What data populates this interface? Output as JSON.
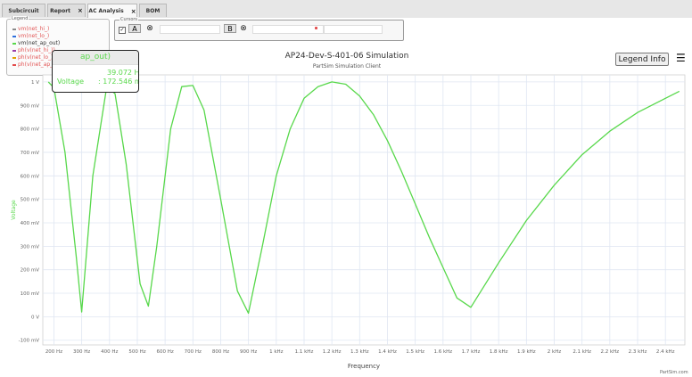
{
  "tabs": [
    {
      "label": "Subcircuit",
      "active": false,
      "close": ""
    },
    {
      "label": "Report",
      "active": false,
      "close": "×"
    },
    {
      "label": "AC Analysis",
      "active": true,
      "close": "×"
    },
    {
      "label": "BOM",
      "active": false,
      "close": ""
    }
  ],
  "cursors": {
    "title": "Cursors",
    "checkbox": "✓",
    "button_a": "A",
    "button_b": "B",
    "x_icon": "⊗"
  },
  "legend": {
    "title": "Legend",
    "items": [
      {
        "label": "vm(net_hi_)",
        "color": "#8a8a8a",
        "selected": false
      },
      {
        "label": "vm(net_lo_)",
        "color": "#2f6fdc",
        "selected": false
      },
      {
        "label": "vm(net_ap_out)",
        "color": "#58d84b",
        "selected": true
      },
      {
        "label": "ph(v(net_hi_))",
        "color": "#9a3ca8",
        "selected": false
      },
      {
        "label": "ph(v(net_lo_))",
        "color": "#e3a000",
        "selected": false
      },
      {
        "label": "ph(v(net_ap_out))",
        "color": "#e34b4b",
        "selected": false
      }
    ]
  },
  "tooltip": {
    "header": "ap_out)",
    "frequency": "39.072 Hz",
    "voltage_label": "Voltage",
    "voltage_value": ": 172.546 mV"
  },
  "header": {
    "title": "AP24-Dev-S-401-06 Simulation",
    "subtitle": "PartSim Simulation Client",
    "legend_info": "Legend Info",
    "menu_icon": "☰"
  },
  "watermark": "PartSim.com",
  "chart_data": {
    "type": "line",
    "xlabel": "Frequency",
    "ylabel": "Voltage",
    "xlim": [
      160,
      2470
    ],
    "ylim": [
      -120,
      1030
    ],
    "x_ticks": [
      200,
      300,
      400,
      500,
      600,
      700,
      800,
      900,
      1000,
      1100,
      1200,
      1300,
      1400,
      1500,
      1600,
      1700,
      1800,
      1900,
      2000,
      2100,
      2200,
      2300,
      2400
    ],
    "x_tick_labels": [
      "200 Hz",
      "300 Hz",
      "400 Hz",
      "500 Hz",
      "600 Hz",
      "700 Hz",
      "800 Hz",
      "900 Hz",
      "1 kHz",
      "1.1 kHz",
      "1.2 kHz",
      "1.3 kHz",
      "1.4 kHz",
      "1.5 kHz",
      "1.6 kHz",
      "1.7 kHz",
      "1.8 kHz",
      "1.9 kHz",
      "2 kHz",
      "2.1 kHz",
      "2.2 kHz",
      "2.3 kHz",
      "2.4 kHz"
    ],
    "y_ticks": [
      -100,
      0,
      100,
      200,
      300,
      400,
      500,
      600,
      700,
      800,
      900,
      1000
    ],
    "y_tick_labels": [
      "-100 mV",
      "0 V",
      "100 mV",
      "200 mV",
      "300 mV",
      "400 mV",
      "500 mV",
      "600 mV",
      "700 mV",
      "800 mV",
      "900 mV",
      "1 V"
    ],
    "series": [
      {
        "color": "#58d84b",
        "x": [
          180,
          200,
          240,
          280,
          300,
          340,
          390,
          420,
          460,
          510,
          540,
          570,
          620,
          660,
          700,
          740,
          800,
          860,
          900,
          950,
          1000,
          1050,
          1100,
          1150,
          1200,
          1250,
          1300,
          1350,
          1400,
          1450,
          1500,
          1550,
          1600,
          1650,
          1700,
          1800,
          1900,
          2000,
          2100,
          2200,
          2300,
          2400,
          2450
        ],
        "y": [
          1000,
          975,
          700,
          260,
          20,
          600,
          980,
          950,
          650,
          140,
          45,
          300,
          800,
          980,
          985,
          880,
          500,
          110,
          15,
          300,
          600,
          800,
          930,
          980,
          1000,
          990,
          940,
          860,
          750,
          620,
          480,
          340,
          210,
          80,
          40,
          230,
          410,
          560,
          690,
          790,
          870,
          930,
          960
        ]
      }
    ]
  }
}
